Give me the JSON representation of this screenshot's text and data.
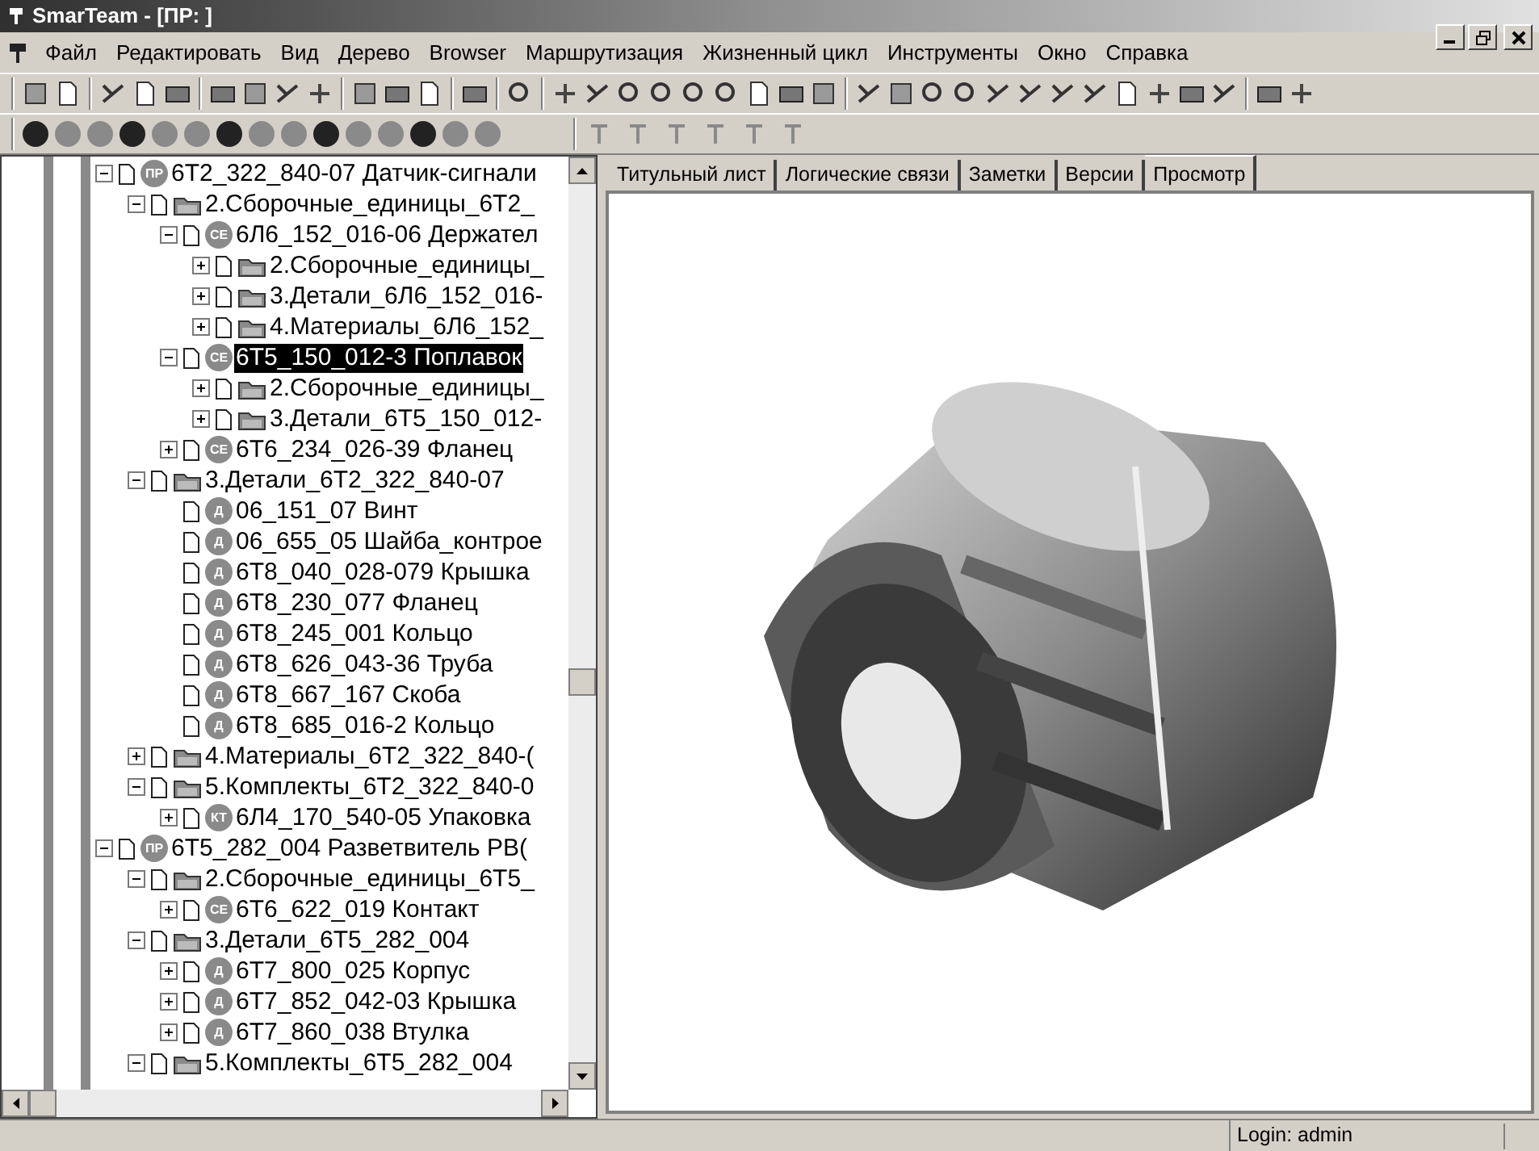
{
  "window": {
    "title": "SmarTeam - [ПР: ]"
  },
  "menu": [
    "Файл",
    "Редактировать",
    "Вид",
    "Дерево",
    "Browser",
    "Маршрутизация",
    "Жизненный цикл",
    "Инструменты",
    "Окно",
    "Справка"
  ],
  "tree": [
    {
      "label": "6Т2_322_840-07 Датчик-сигнали",
      "kind": "item",
      "badge": "ПР",
      "expanded": true,
      "selected": false,
      "children": [
        {
          "label": "2.Сборочные_единицы_6Т2_",
          "kind": "folder",
          "expanded": true,
          "selected": false,
          "children": [
            {
              "label": "6Л6_152_016-06 Держател",
              "kind": "item",
              "badge": "СЕ",
              "expanded": true,
              "selected": false,
              "children": [
                {
                  "label": "2.Сборочные_единицы_",
                  "kind": "folder",
                  "expanded": false,
                  "selected": false
                },
                {
                  "label": "3.Детали_6Л6_152_016-",
                  "kind": "folder",
                  "expanded": false,
                  "selected": false
                },
                {
                  "label": "4.Материалы_6Л6_152_",
                  "kind": "folder",
                  "expanded": false,
                  "selected": false
                }
              ]
            },
            {
              "label": "6Т5_150_012-3 Поплавок",
              "kind": "item",
              "badge": "СЕ",
              "expanded": true,
              "selected": true,
              "children": [
                {
                  "label": "2.Сборочные_единицы_",
                  "kind": "folder",
                  "expanded": false,
                  "selected": false
                },
                {
                  "label": "3.Детали_6Т5_150_012-",
                  "kind": "folder",
                  "expanded": false,
                  "selected": false
                }
              ]
            },
            {
              "label": "6Т6_234_026-39 Фланец",
              "kind": "item",
              "badge": "СЕ",
              "expanded": false,
              "selected": false
            }
          ]
        },
        {
          "label": "3.Детали_6Т2_322_840-07",
          "kind": "folder",
          "expanded": true,
          "selected": false,
          "children": [
            {
              "label": "06_151_07 Винт",
              "kind": "item",
              "badge": "Д",
              "selected": false
            },
            {
              "label": "06_655_05 Шайба_контрое",
              "kind": "item",
              "badge": "Д",
              "selected": false
            },
            {
              "label": "6Т8_040_028-079 Крышка",
              "kind": "item",
              "badge": "Д",
              "selected": false
            },
            {
              "label": "6Т8_230_077 Фланец",
              "kind": "item",
              "badge": "Д",
              "selected": false
            },
            {
              "label": "6Т8_245_001 Кольцо",
              "kind": "item",
              "badge": "Д",
              "selected": false
            },
            {
              "label": "6Т8_626_043-36 Труба",
              "kind": "item",
              "badge": "Д",
              "selected": false
            },
            {
              "label": "6Т8_667_167 Скоба",
              "kind": "item",
              "badge": "Д",
              "selected": false
            },
            {
              "label": "6Т8_685_016-2 Кольцо",
              "kind": "item",
              "badge": "Д",
              "selected": false
            }
          ]
        },
        {
          "label": "4.Материалы_6Т2_322_840-(",
          "kind": "folder",
          "expanded": false,
          "selected": false
        },
        {
          "label": "5.Комплекты_6Т2_322_840-0",
          "kind": "folder",
          "expanded": true,
          "selected": false,
          "children": [
            {
              "label": "6Л4_170_540-05 Упаковка",
              "kind": "item",
              "badge": "КТ",
              "expanded": false,
              "selected": false
            }
          ]
        }
      ]
    },
    {
      "label": "6Т5_282_004 Разветвитель РВ(",
      "kind": "item",
      "badge": "ПР",
      "expanded": true,
      "selected": false,
      "children": [
        {
          "label": "2.Сборочные_единицы_6Т5_",
          "kind": "folder",
          "expanded": true,
          "selected": false,
          "children": [
            {
              "label": "6Т6_622_019 Контакт",
              "kind": "item",
              "badge": "СЕ",
              "expanded": false,
              "selected": false
            }
          ]
        },
        {
          "label": "3.Детали_6Т5_282_004",
          "kind": "folder",
          "expanded": true,
          "selected": false,
          "children": [
            {
              "label": "6Т7_800_025 Корпус",
              "kind": "item",
              "badge": "Д",
              "expanded": false,
              "selected": false
            },
            {
              "label": "6Т7_852_042-03 Крышка",
              "kind": "item",
              "badge": "Д",
              "expanded": false,
              "selected": false
            },
            {
              "label": "6Т7_860_038 Втулка",
              "kind": "item",
              "badge": "Д",
              "expanded": false,
              "selected": false
            }
          ]
        },
        {
          "label": "5.Комплекты_6Т5_282_004",
          "kind": "folder",
          "expanded": true,
          "selected": false
        }
      ]
    }
  ],
  "tabs": [
    {
      "label": "Титульный лист",
      "selected": false
    },
    {
      "label": "Логические связи",
      "selected": false
    },
    {
      "label": "Заметки",
      "selected": false
    },
    {
      "label": "Версии",
      "selected": false
    },
    {
      "label": "Просмотр",
      "selected": true
    }
  ],
  "status_bar": {
    "login": "Login: admin"
  }
}
